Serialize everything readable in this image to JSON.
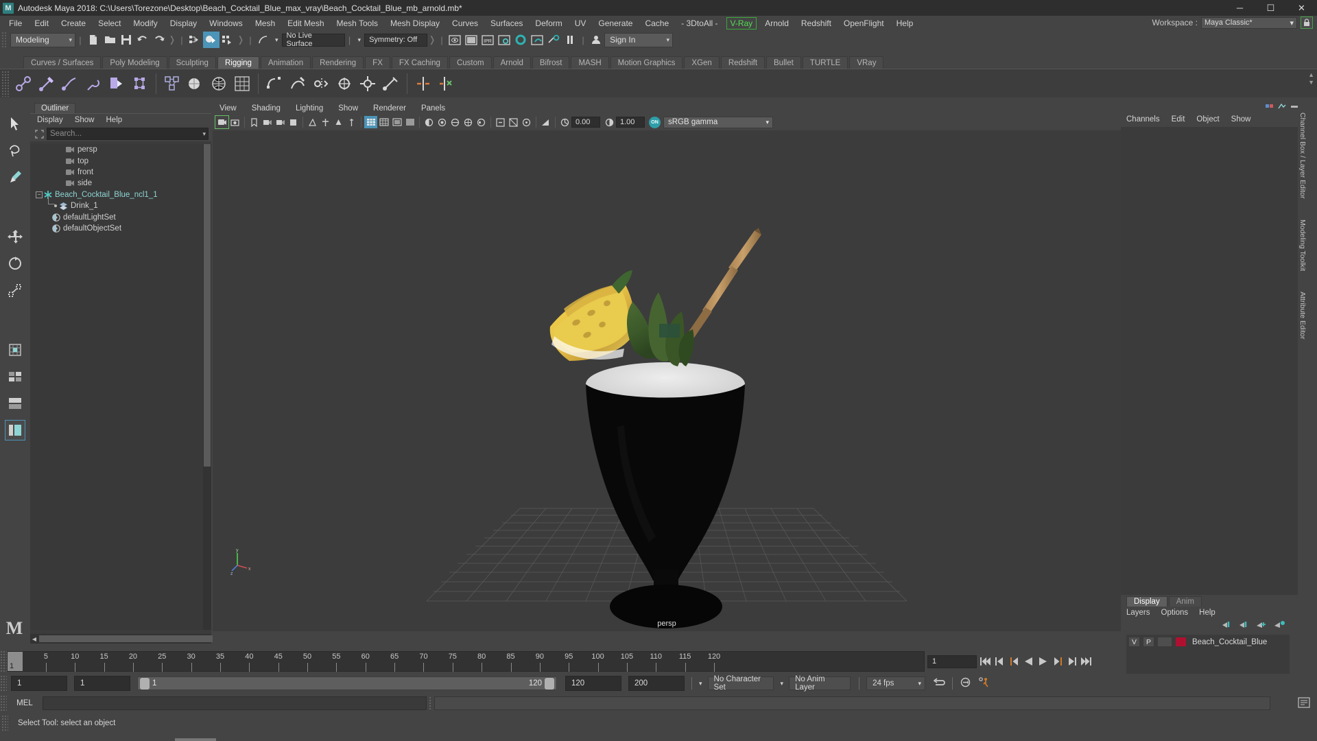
{
  "window": {
    "title": "Autodesk Maya 2018: C:\\Users\\Torezone\\Desktop\\Beach_Cocktail_Blue_max_vray\\Beach_Cocktail_Blue_mb_arnold.mb*",
    "logo_letter": "M",
    "minimize": "─",
    "maximize": "☐",
    "close": "✕"
  },
  "menubar": {
    "items": [
      {
        "label": "File"
      },
      {
        "label": "Edit"
      },
      {
        "label": "Create"
      },
      {
        "label": "Select"
      },
      {
        "label": "Modify"
      },
      {
        "label": "Display"
      },
      {
        "label": "Windows"
      },
      {
        "label": "Mesh"
      },
      {
        "label": "Edit Mesh"
      },
      {
        "label": "Mesh Tools"
      },
      {
        "label": "Mesh Display"
      },
      {
        "label": "Curves"
      },
      {
        "label": "Surfaces"
      },
      {
        "label": "Deform"
      },
      {
        "label": "UV"
      },
      {
        "label": "Generate"
      },
      {
        "label": "Cache"
      },
      {
        "label": "- 3DtoAll -"
      },
      {
        "label": "V-Ray",
        "style": "vray"
      },
      {
        "label": "Arnold"
      },
      {
        "label": "Redshift"
      },
      {
        "label": "OpenFlight"
      },
      {
        "label": "Help"
      }
    ],
    "workspace_label": "Workspace :",
    "workspace_value": "Maya Classic*",
    "lock_icon": "lock-icon"
  },
  "statusline": {
    "menuset": "Modeling",
    "live_surface": "No Live Surface",
    "symmetry": "Symmetry: Off",
    "signin": "Sign In",
    "caret": "▼"
  },
  "shelf": {
    "tabs": [
      {
        "label": "Curves / Surfaces",
        "active": false
      },
      {
        "label": "Poly Modeling",
        "active": false
      },
      {
        "label": "Sculpting",
        "active": false
      },
      {
        "label": "Rigging",
        "active": true
      },
      {
        "label": "Animation",
        "active": false
      },
      {
        "label": "Rendering",
        "active": false
      },
      {
        "label": "FX",
        "active": false
      },
      {
        "label": "FX Caching",
        "active": false
      },
      {
        "label": "Custom",
        "active": false
      },
      {
        "label": "Arnold",
        "active": false
      },
      {
        "label": "Bifrost",
        "active": false
      },
      {
        "label": "MASH",
        "active": false
      },
      {
        "label": "Motion Graphics",
        "active": false
      },
      {
        "label": "XGen",
        "active": false
      },
      {
        "label": "Redshift",
        "active": false
      },
      {
        "label": "Bullet",
        "active": false
      },
      {
        "label": "TURTLE",
        "active": false
      },
      {
        "label": "VRay",
        "active": false
      }
    ]
  },
  "outliner": {
    "tab": "Outliner",
    "menus": [
      "Display",
      "Show",
      "Help"
    ],
    "search_placeholder": "Search...",
    "items": [
      {
        "label": "persp",
        "icon": "camera-icon",
        "dim": true,
        "indent": 52,
        "expander": false
      },
      {
        "label": "top",
        "icon": "camera-icon",
        "dim": true,
        "indent": 52,
        "expander": false
      },
      {
        "label": "front",
        "icon": "camera-icon",
        "dim": true,
        "indent": 52,
        "expander": false
      },
      {
        "label": "side",
        "icon": "camera-icon",
        "dim": true,
        "indent": 52,
        "expander": false
      },
      {
        "label": "Beach_Cocktail_Blue_ncl1_1",
        "icon": "asterisk-icon",
        "dim": false,
        "indent": 20,
        "expander": true
      },
      {
        "label": "Drink_1",
        "icon": "mesh-icon",
        "dim": false,
        "indent": 42,
        "expander": false
      },
      {
        "label": "defaultLightSet",
        "icon": "set-icon",
        "dim": false,
        "indent": 32,
        "expander": false
      },
      {
        "label": "defaultObjectSet",
        "icon": "set-icon",
        "dim": false,
        "indent": 32,
        "expander": false
      }
    ]
  },
  "viewport": {
    "menus": [
      "View",
      "Shading",
      "Lighting",
      "Show",
      "Renderer",
      "Panels"
    ],
    "exposure": "0.00",
    "gamma": "1.00",
    "colorspace": "sRGB gamma",
    "on_badge": "ON",
    "camera_label": "persp"
  },
  "channelbox": {
    "menus": [
      "Channels",
      "Edit",
      "Object",
      "Show"
    ],
    "side_labels": [
      "Channel Box / Layer Editor",
      "Modeling Toolkit",
      "Attribute Editor"
    ]
  },
  "layers": {
    "tabs": [
      {
        "label": "Display",
        "active": true
      },
      {
        "label": "Anim",
        "active": false
      }
    ],
    "menus": [
      "Layers",
      "Options",
      "Help"
    ],
    "rows": [
      {
        "v": "V",
        "p": "P",
        "color": "#b01030",
        "name": "Beach_Cocktail_Blue"
      }
    ]
  },
  "timeline": {
    "current_frame": "1",
    "current_frame_right": "1",
    "ticks": [
      5,
      10,
      15,
      20,
      25,
      30,
      35,
      40,
      45,
      50,
      55,
      60,
      65,
      70,
      75,
      80,
      85,
      90,
      95,
      100,
      105,
      110,
      115,
      120
    ],
    "start": 1,
    "end": 120
  },
  "range": {
    "anim_start": "1",
    "range_start": "1",
    "slider_min_label": "1",
    "slider_max_label": "120",
    "range_end": "120",
    "anim_end": "200",
    "character_set": "No Character Set",
    "anim_layer": "No Anim Layer",
    "fps": "24 fps"
  },
  "commandline": {
    "lang_label": "MEL",
    "input_value": ""
  },
  "helpline": {
    "text": "Select Tool: select an object"
  },
  "colors": {
    "accent_blue": "#4c94b8",
    "teal": "#2f9e9e",
    "vray_green": "#55dd55",
    "orange": "#d07a28",
    "layer_swatch": "#b01030"
  }
}
